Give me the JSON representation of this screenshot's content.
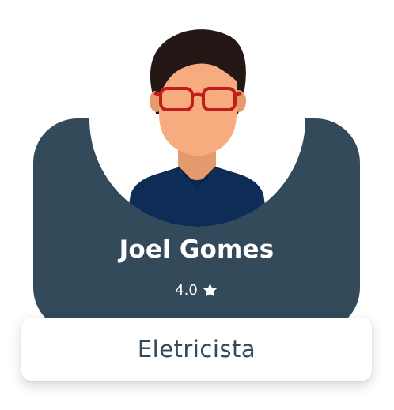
{
  "profile": {
    "name": "Joel Gomes",
    "rating": "4.0",
    "rating_icon": "star-icon",
    "profession": "Eletricista",
    "avatar_icon": "person-with-glasses-avatar"
  },
  "colors": {
    "card_bg": "#324a5a",
    "text_light": "#ffffff",
    "profession_text": "#324a5a",
    "hair": "#231815",
    "skin": "#f6ac7e",
    "neck": "#e59a6d",
    "shirt": "#0d2d57",
    "glasses": "#c11d1d"
  }
}
